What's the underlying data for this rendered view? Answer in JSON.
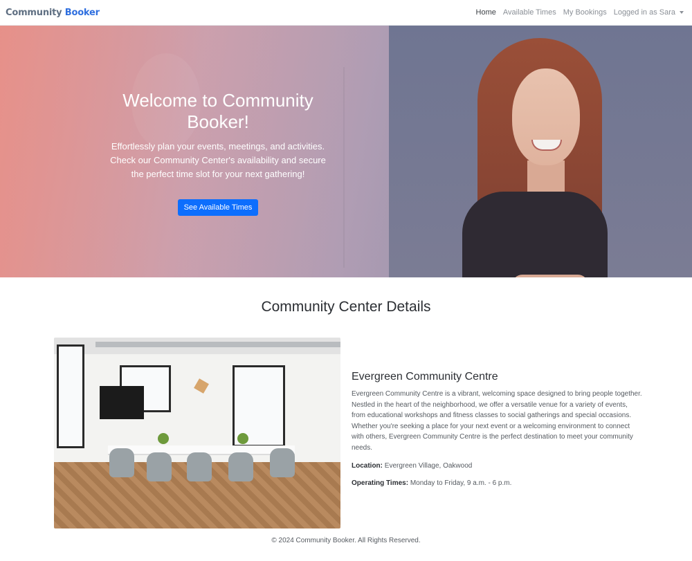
{
  "navbar": {
    "brand_part1": "Community",
    "brand_part2": "Booker",
    "links": [
      {
        "label": "Home",
        "active": true
      },
      {
        "label": "Available Times",
        "active": false
      },
      {
        "label": "My Bookings",
        "active": false
      }
    ],
    "user_menu_label": "Logged in as Sara"
  },
  "hero": {
    "title": "Welcome to Community Booker!",
    "subtitle": "Effortlessly plan your events, meetings, and activities. Check our Community Center's availability and secure the perfect time slot for your next gathering!",
    "button_label": "See Available Times",
    "button_color": "#0d6efd"
  },
  "details": {
    "section_title": "Community Center Details",
    "center_name": "Evergreen Community Centre",
    "description": "Evergreen Community Centre is a vibrant, welcoming space designed to bring people together. Nestled in the heart of the neighborhood, we offer a versatile venue for a variety of events, from educational workshops and fitness classes to social gatherings and special occasions. Whether you're seeking a place for your next event or a welcoming environment to connect with others, Evergreen Community Centre is the perfect destination to meet your community needs.",
    "location_label": "Location:",
    "location_value": "Evergreen Village, Oakwood",
    "hours_label": "Operating Times:",
    "hours_value": "Monday to Friday, 9 a.m. - 6 p.m."
  },
  "footer": {
    "text": "© 2024 Community Booker. All Rights Reserved."
  }
}
